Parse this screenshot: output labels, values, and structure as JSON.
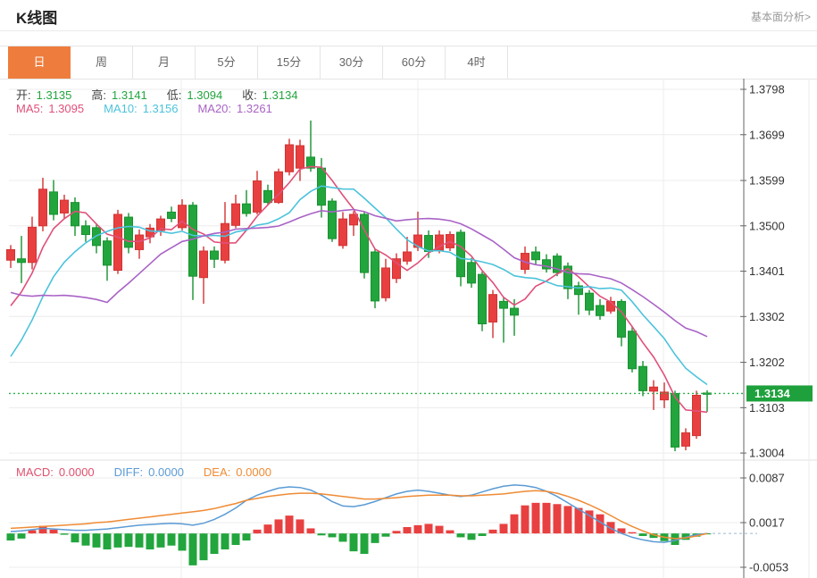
{
  "header": {
    "title": "K线图",
    "link": "基本面分析>"
  },
  "tabs": {
    "active_index": 0,
    "items": [
      "日",
      "周",
      "月",
      "5分",
      "15分",
      "30分",
      "60分",
      "4时"
    ]
  },
  "legend": {
    "ohlc": [
      {
        "label": "开:",
        "value": "1.3135"
      },
      {
        "label": "高:",
        "value": "1.3141"
      },
      {
        "label": "低:",
        "value": "1.3094"
      },
      {
        "label": "收:",
        "value": "1.3134"
      }
    ],
    "ma": [
      {
        "label": "MA5:",
        "value": "1.3095",
        "color": "#e0507a"
      },
      {
        "label": "MA10:",
        "value": "1.3156",
        "color": "#4cc3dc"
      },
      {
        "label": "MA20:",
        "value": "1.3261",
        "color": "#a963c6"
      }
    ],
    "macd": [
      {
        "label": "MACD:",
        "value": "0.0000",
        "color": "#e0506e"
      },
      {
        "label": "DIFF:",
        "value": "0.0000",
        "color": "#5b9bd5"
      },
      {
        "label": "DEA:",
        "value": "0.0000",
        "color": "#ef8b34"
      }
    ]
  },
  "colors": {
    "up": "#e84040",
    "up_stroke": "#d23232",
    "down": "#22a53d",
    "down_stroke": "#17922f",
    "ma5": "#e0507a",
    "ma10": "#4cc3dc",
    "ma20": "#a963c6",
    "diff": "#5b9bd5",
    "dea": "#ef8b34",
    "price_line": "#2bb24c",
    "badge_bg": "#1ea13c",
    "badge_text": "#ffffff",
    "grid": "#ececec",
    "axis_line": "#666666",
    "axis_text": "#333333",
    "accent_tab": "#ee7d3d"
  },
  "chart_data": [
    {
      "type": "candlestick",
      "title": "K线图 (日)",
      "legend_position": "top-left",
      "grid": true,
      "y_axis_labels": [
        "1.3798",
        "1.3699",
        "1.3599",
        "1.3500",
        "1.3401",
        "1.3302",
        "1.3202",
        "1.3103",
        "1.3004"
      ],
      "ylim": [
        1.2988,
        1.3821
      ],
      "current_price": "1.3134",
      "ma_periods": [
        5,
        10,
        20
      ],
      "ma_seed_closes": [
        1.354,
        1.354,
        1.354,
        1.354,
        1.354,
        1.354,
        1.354,
        1.354,
        1.354,
        1.354,
        1.308,
        1.306,
        1.306,
        1.307,
        1.309,
        1.324,
        1.327,
        1.329,
        1.33,
        1.332
      ],
      "candles_ohlc": [
        [
          1.3425,
          1.3458,
          1.3408,
          1.3448
        ],
        [
          1.3428,
          1.3478,
          1.3375,
          1.342
        ],
        [
          1.342,
          1.352,
          1.3405,
          1.3497
        ],
        [
          1.35,
          1.3605,
          1.3488,
          1.358
        ],
        [
          1.3574,
          1.36,
          1.3512,
          1.3525
        ],
        [
          1.3528,
          1.3568,
          1.3515,
          1.3556
        ],
        [
          1.3551,
          1.3562,
          1.3478,
          1.35
        ],
        [
          1.35,
          1.3512,
          1.3465,
          1.3481
        ],
        [
          1.3496,
          1.3505,
          1.344,
          1.3457
        ],
        [
          1.3467,
          1.3475,
          1.338,
          1.3414
        ],
        [
          1.3403,
          1.3535,
          1.3395,
          1.3525
        ],
        [
          1.3519,
          1.3528,
          1.344,
          1.3453
        ],
        [
          1.3448,
          1.3492,
          1.3428,
          1.348
        ],
        [
          1.3476,
          1.3504,
          1.3462,
          1.3495
        ],
        [
          1.349,
          1.3522,
          1.3478,
          1.3515
        ],
        [
          1.353,
          1.3542,
          1.3508,
          1.3516
        ],
        [
          1.3496,
          1.3558,
          1.349,
          1.3545
        ],
        [
          1.3545,
          1.3552,
          1.3338,
          1.339
        ],
        [
          1.3387,
          1.3455,
          1.333,
          1.3445
        ],
        [
          1.3445,
          1.3455,
          1.3408,
          1.3427
        ],
        [
          1.3425,
          1.3552,
          1.3418,
          1.3505
        ],
        [
          1.3501,
          1.3568,
          1.3495,
          1.3548
        ],
        [
          1.3548,
          1.3578,
          1.352,
          1.3527
        ],
        [
          1.353,
          1.362,
          1.3525,
          1.3598
        ],
        [
          1.3577,
          1.359,
          1.3545,
          1.3551
        ],
        [
          1.3551,
          1.3625,
          1.3548,
          1.3618
        ],
        [
          1.3618,
          1.369,
          1.361,
          1.3677
        ],
        [
          1.3626,
          1.3688,
          1.3598,
          1.3675
        ],
        [
          1.365,
          1.373,
          1.3618,
          1.3626
        ],
        [
          1.3626,
          1.3648,
          1.3518,
          1.3545
        ],
        [
          1.3554,
          1.356,
          1.3465,
          1.3472
        ],
        [
          1.3457,
          1.353,
          1.345,
          1.3515
        ],
        [
          1.3502,
          1.3532,
          1.3478,
          1.3525
        ],
        [
          1.3525,
          1.353,
          1.3385,
          1.3398
        ],
        [
          1.3443,
          1.345,
          1.332,
          1.3336
        ],
        [
          1.3343,
          1.3428,
          1.3335,
          1.3408
        ],
        [
          1.3385,
          1.344,
          1.3375,
          1.3428
        ],
        [
          1.3423,
          1.3476,
          1.3415,
          1.3443
        ],
        [
          1.3453,
          1.3531,
          1.3445,
          1.348
        ],
        [
          1.3479,
          1.349,
          1.343,
          1.3444
        ],
        [
          1.3447,
          1.349,
          1.344,
          1.348
        ],
        [
          1.3452,
          1.3488,
          1.3445,
          1.3481
        ],
        [
          1.3486,
          1.3492,
          1.3368,
          1.3389
        ],
        [
          1.342,
          1.343,
          1.3365,
          1.3375
        ],
        [
          1.3394,
          1.34,
          1.327,
          1.3286
        ],
        [
          1.329,
          1.336,
          1.3255,
          1.335
        ],
        [
          1.3335,
          1.3345,
          1.3245,
          1.332
        ],
        [
          1.332,
          1.334,
          1.326,
          1.3305
        ],
        [
          1.3405,
          1.3455,
          1.3395,
          1.344
        ],
        [
          1.3443,
          1.3455,
          1.3415,
          1.3426
        ],
        [
          1.3426,
          1.3438,
          1.3398,
          1.3406
        ],
        [
          1.3434,
          1.344,
          1.339,
          1.3398
        ],
        [
          1.3412,
          1.342,
          1.334,
          1.3363
        ],
        [
          1.3369,
          1.3378,
          1.3306,
          1.335
        ],
        [
          1.3353,
          1.336,
          1.3305,
          1.3316
        ],
        [
          1.3326,
          1.334,
          1.3295,
          1.3304
        ],
        [
          1.3314,
          1.3345,
          1.3308,
          1.3335
        ],
        [
          1.3335,
          1.334,
          1.3237,
          1.3257
        ],
        [
          1.327,
          1.328,
          1.318,
          1.3188
        ],
        [
          1.3193,
          1.3205,
          1.3128,
          1.314
        ],
        [
          1.3139,
          1.3163,
          1.3098,
          1.3148
        ],
        [
          1.312,
          1.3158,
          1.3102,
          1.3137
        ],
        [
          1.3134,
          1.314,
          1.3008,
          1.3017
        ],
        [
          1.3019,
          1.3058,
          1.301,
          1.3048
        ],
        [
          1.3042,
          1.314,
          1.3035,
          1.313
        ],
        [
          1.3135,
          1.3141,
          1.3094,
          1.3134
        ]
      ]
    },
    {
      "type": "bar",
      "title": "MACD",
      "y_axis_labels": [
        "0.0087",
        "0.0017",
        "-0.0053"
      ],
      "ylim": [
        -0.0066,
        0.0094
      ],
      "histogram": [
        -0.0011,
        -0.0008,
        0.0005,
        0.0012,
        0.0006,
        -0.0002,
        -0.0014,
        -0.0019,
        -0.0022,
        -0.0025,
        -0.0022,
        -0.0021,
        -0.0022,
        -0.0025,
        -0.0022,
        -0.0019,
        -0.0027,
        -0.005,
        -0.0042,
        -0.0032,
        -0.0025,
        -0.0018,
        -0.0011,
        0.0006,
        0.0014,
        0.0022,
        0.0028,
        0.0022,
        0.0008,
        -0.0003,
        -0.0006,
        -0.0013,
        -0.0028,
        -0.0032,
        -0.0015,
        -0.0005,
        0.0004,
        0.001,
        0.0013,
        0.0015,
        0.0012,
        0.0005,
        -0.0006,
        -0.001,
        -0.0004,
        0.0006,
        0.0015,
        0.003,
        0.0044,
        0.0048,
        0.0048,
        0.0046,
        0.0043,
        0.004,
        0.0036,
        0.003,
        0.0018,
        0.0008,
        0.0002,
        -0.0004,
        -0.0007,
        -0.0012,
        -0.0018,
        -0.001,
        -0.0005,
        -0.0001
      ],
      "diff": [
        0.0003,
        0.0004,
        0.0006,
        0.0008,
        0.0007,
        0.0006,
        0.0005,
        0.0005,
        0.0006,
        0.0007,
        0.0009,
        0.0011,
        0.0013,
        0.0014,
        0.0015,
        0.0016,
        0.0015,
        0.0013,
        0.0016,
        0.0022,
        0.003,
        0.004,
        0.0052,
        0.006,
        0.0066,
        0.0071,
        0.0073,
        0.0072,
        0.0068,
        0.006,
        0.005,
        0.0043,
        0.0042,
        0.0045,
        0.005,
        0.0056,
        0.0062,
        0.0066,
        0.0068,
        0.0066,
        0.0063,
        0.006,
        0.0058,
        0.006,
        0.0065,
        0.007,
        0.0074,
        0.0076,
        0.0075,
        0.0072,
        0.0066,
        0.0058,
        0.0048,
        0.0038,
        0.0028,
        0.0018,
        0.0008,
        0.0,
        -0.0006,
        -0.001,
        -0.0013,
        -0.0014,
        -0.0011,
        -0.0006,
        -0.0002,
        0.0
      ],
      "dea": [
        0.0008,
        0.0009,
        0.001,
        0.0011,
        0.0012,
        0.0013,
        0.0014,
        0.0015,
        0.0017,
        0.0018,
        0.002,
        0.0022,
        0.0024,
        0.0026,
        0.0028,
        0.003,
        0.0032,
        0.0034,
        0.0036,
        0.0039,
        0.0043,
        0.0047,
        0.0052,
        0.0055,
        0.0058,
        0.006,
        0.0062,
        0.0063,
        0.0063,
        0.0062,
        0.006,
        0.0058,
        0.0056,
        0.0054,
        0.0054,
        0.0055,
        0.0056,
        0.0058,
        0.0059,
        0.006,
        0.006,
        0.006,
        0.0059,
        0.0059,
        0.006,
        0.0061,
        0.0062,
        0.0064,
        0.0066,
        0.0067,
        0.0066,
        0.0063,
        0.0058,
        0.0052,
        0.0045,
        0.0037,
        0.0028,
        0.0019,
        0.0011,
        0.0004,
        -0.0002,
        -0.0006,
        -0.0008,
        -0.0007,
        -0.0004,
        0.0
      ]
    }
  ]
}
